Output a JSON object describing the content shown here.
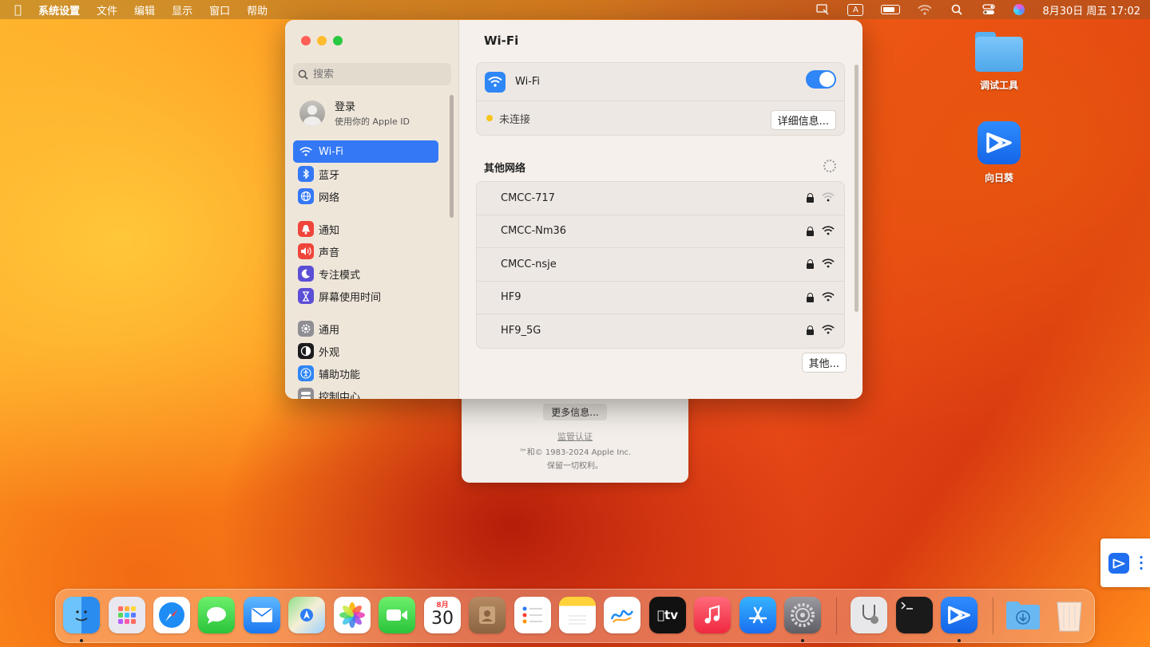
{
  "menubar": {
    "app_name": "系统设置",
    "items": [
      "文件",
      "编辑",
      "显示",
      "窗口",
      "帮助"
    ],
    "ime_label": "A",
    "clock": "8月30日 周五 17:02"
  },
  "desktop": {
    "icons": [
      {
        "label": "调试工具",
        "icon": "folder-icon"
      },
      {
        "label": "向日葵",
        "icon": "sunlogin-icon"
      }
    ]
  },
  "about_window": {
    "more_info_button": "更多信息...",
    "regulatory_link": "监管认证",
    "copyright_line1": "™和© 1983-2024 Apple Inc.",
    "copyright_line2": "保留一切权利。"
  },
  "sidebar": {
    "search_placeholder": "搜索",
    "account": {
      "title": "登录",
      "subtitle": "使用你的 Apple ID"
    },
    "groups": [
      [
        {
          "label": "Wi-Fi",
          "icon": "wifi-icon",
          "color": "#3478f6",
          "active": true
        },
        {
          "label": "蓝牙",
          "icon": "bluetooth-icon",
          "color": "#3478f6"
        },
        {
          "label": "网络",
          "icon": "globe-icon",
          "color": "#3478f6"
        }
      ],
      [
        {
          "label": "通知",
          "icon": "bell-icon",
          "color": "#f0453a"
        },
        {
          "label": "声音",
          "icon": "speaker-icon",
          "color": "#f0453a"
        },
        {
          "label": "专注模式",
          "icon": "moon-icon",
          "color": "#5b4fd6"
        },
        {
          "label": "屏幕使用时间",
          "icon": "hourglass-icon",
          "color": "#5b4fd6"
        }
      ],
      [
        {
          "label": "通用",
          "icon": "gear-icon",
          "color": "#8e8e93"
        },
        {
          "label": "外观",
          "icon": "appearance-icon",
          "color": "#1c1c1e"
        },
        {
          "label": "辅助功能",
          "icon": "accessibility-icon",
          "color": "#2f86f6"
        },
        {
          "label": "控制中心",
          "icon": "control-center-icon",
          "color": "#8e8e93"
        }
      ]
    ]
  },
  "main": {
    "title": "Wi-Fi",
    "wifi_label": "Wi-Fi",
    "wifi_enabled": true,
    "status": "未连接",
    "details_button": "详细信息...",
    "other_networks_title": "其他网络",
    "networks": [
      {
        "name": "CMCC-717",
        "secured": true,
        "strength": "weak"
      },
      {
        "name": "CMCC-Nm36",
        "secured": true,
        "strength": "full"
      },
      {
        "name": "CMCC-nsje",
        "secured": true,
        "strength": "full"
      },
      {
        "name": "HF9",
        "secured": true,
        "strength": "full"
      },
      {
        "name": "HF9_5G",
        "secured": true,
        "strength": "full"
      }
    ],
    "other_button": "其他..."
  },
  "dock": {
    "calendar_month": "8月",
    "calendar_day": "30",
    "tv_label": "tv",
    "apps": [
      "finder",
      "launchpad",
      "safari",
      "messages",
      "mail",
      "maps",
      "photos",
      "facetime",
      "calendar",
      "contacts",
      "reminders",
      "notes",
      "freeform",
      "tv",
      "music",
      "app-store",
      "system-settings",
      "disk-utility",
      "terminal",
      "sunlogin",
      "downloads",
      "trash"
    ]
  },
  "colors": {
    "accent": "#3478f6",
    "status_dot": "#f5c518"
  }
}
